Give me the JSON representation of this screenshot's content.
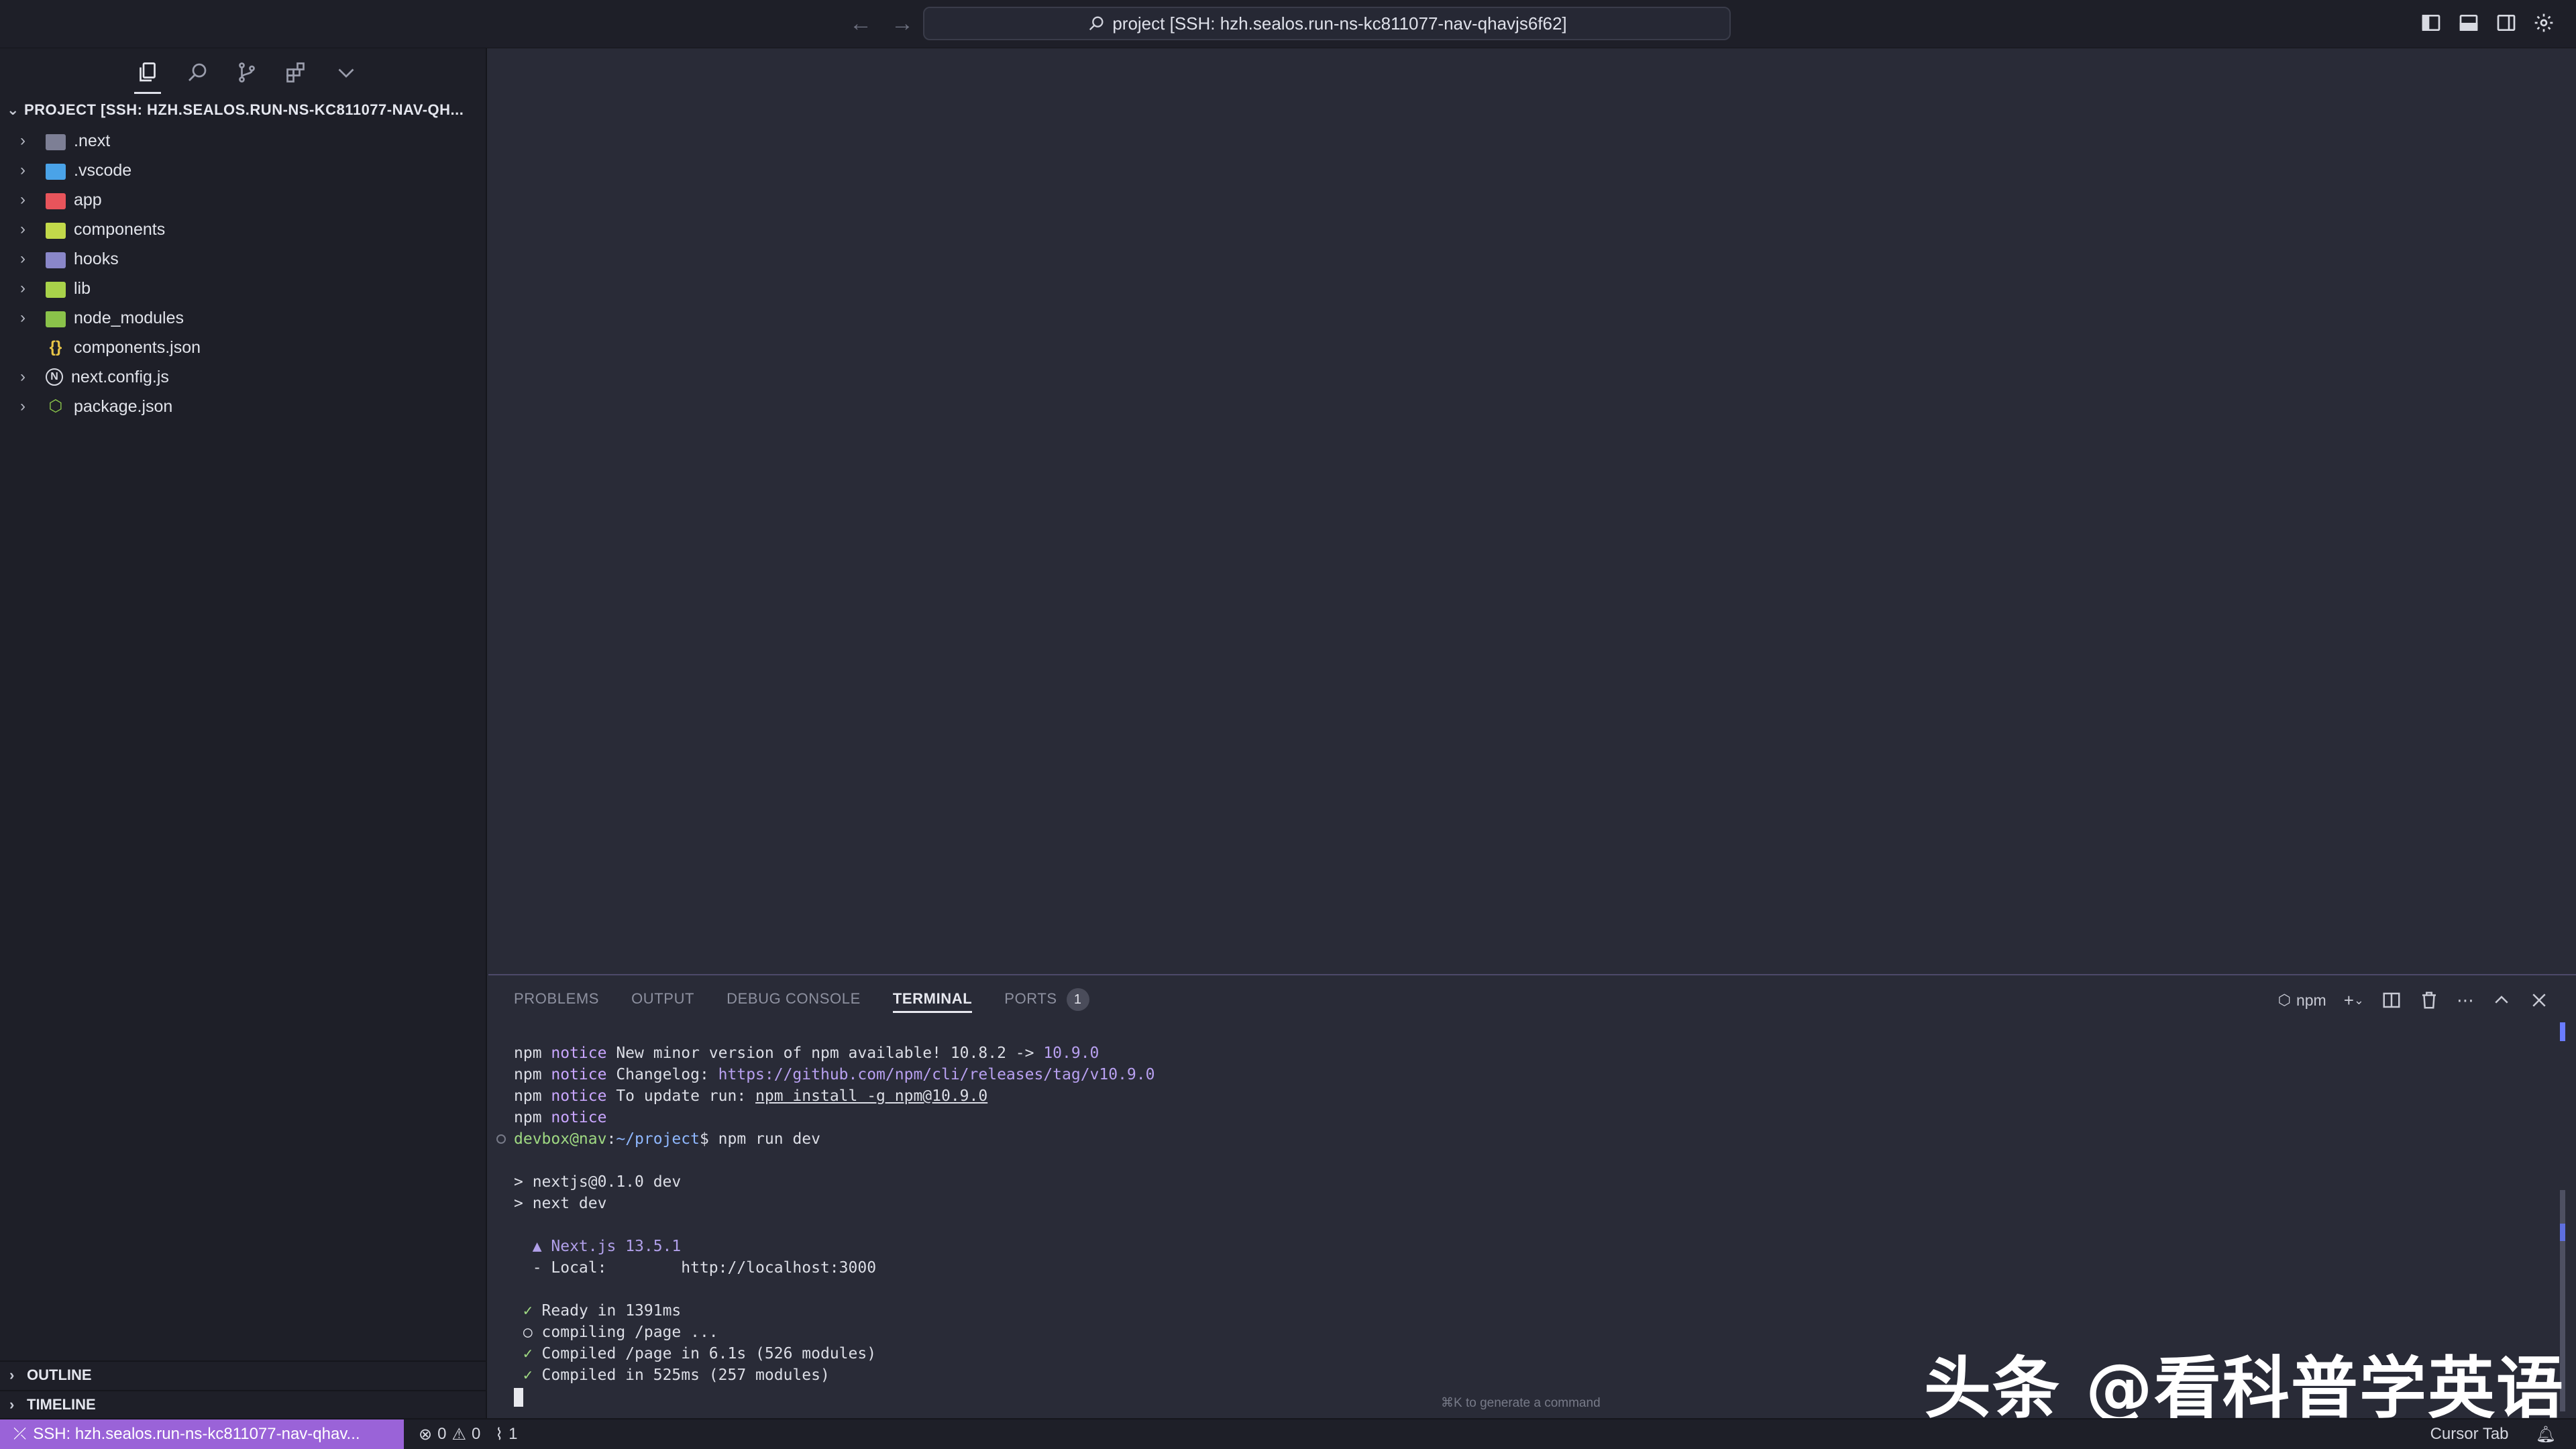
{
  "titlebar": {
    "command_center": "project [SSH: hzh.sealos.run-ns-kc811077-nav-qhavjs6f62]"
  },
  "sidebar": {
    "header": "PROJECT [SSH: HZH.SEALOS.RUN-NS-KC811077-NAV-QH...",
    "items": [
      {
        "label": ".next",
        "type": "folder",
        "color": "#7d7f95"
      },
      {
        "label": ".vscode",
        "type": "folder",
        "color": "#4aa3e8"
      },
      {
        "label": "app",
        "type": "folder",
        "color": "#e8545b"
      },
      {
        "label": "components",
        "type": "folder",
        "color": "#c2d94a"
      },
      {
        "label": "hooks",
        "type": "folder",
        "color": "#8a87c9"
      },
      {
        "label": "lib",
        "type": "folder",
        "color": "#a8d24a"
      },
      {
        "label": "node_modules",
        "type": "folder",
        "color": "#8ac24a"
      },
      {
        "label": "components.json",
        "type": "json"
      },
      {
        "label": "next.config.js",
        "type": "next"
      },
      {
        "label": "package.json",
        "type": "npm"
      }
    ],
    "outline": "OUTLINE",
    "timeline": "TIMELINE"
  },
  "panel": {
    "tabs": [
      {
        "label": "PROBLEMS"
      },
      {
        "label": "OUTPUT"
      },
      {
        "label": "DEBUG CONSOLE"
      },
      {
        "label": "TERMINAL"
      },
      {
        "label": "PORTS",
        "badge": "1"
      }
    ],
    "terminal_name": "npm",
    "hint": "⌘K to generate a command"
  },
  "terminal": {
    "l1a": "npm ",
    "l1b": "notice",
    "l1c": " New minor version of npm available! 10.8.2 -> ",
    "l1d": "10.9.0",
    "l2a": "npm ",
    "l2b": "notice",
    "l2c": " Changelog: ",
    "l2d": "https://github.com/npm/cli/releases/tag/v10.9.0",
    "l3a": "npm ",
    "l3b": "notice",
    "l3c": " To update run: ",
    "l3d": "npm install -g npm@10.9.0",
    "l4a": "npm ",
    "l4b": "notice",
    "l5a": "devbox@nav",
    "l5b": ":",
    "l5c": "~/project",
    "l5d": "$ npm run dev",
    "l7": "> nextjs@0.1.0 dev",
    "l8": "> next dev",
    "l10": "  ▲ Next.js 13.5.1",
    "l11": "  - Local:        http://localhost:3000",
    "l13a": " ✓",
    "l13b": " Ready in 1391ms",
    "l14": " ○ compiling /page ...",
    "l15a": " ✓",
    "l15b": " Compiled /page in 6.1s (526 modules)",
    "l16a": " ✓",
    "l16b": " Compiled in 525ms (257 modules)"
  },
  "statusbar": {
    "remote": "SSH: hzh.sealos.run-ns-kc811077-nav-qhav...",
    "errors": "0",
    "warnings": "0",
    "ports": "1",
    "cursor_tab": "Cursor Tab"
  },
  "watermark": "头条 @看科普学英语"
}
